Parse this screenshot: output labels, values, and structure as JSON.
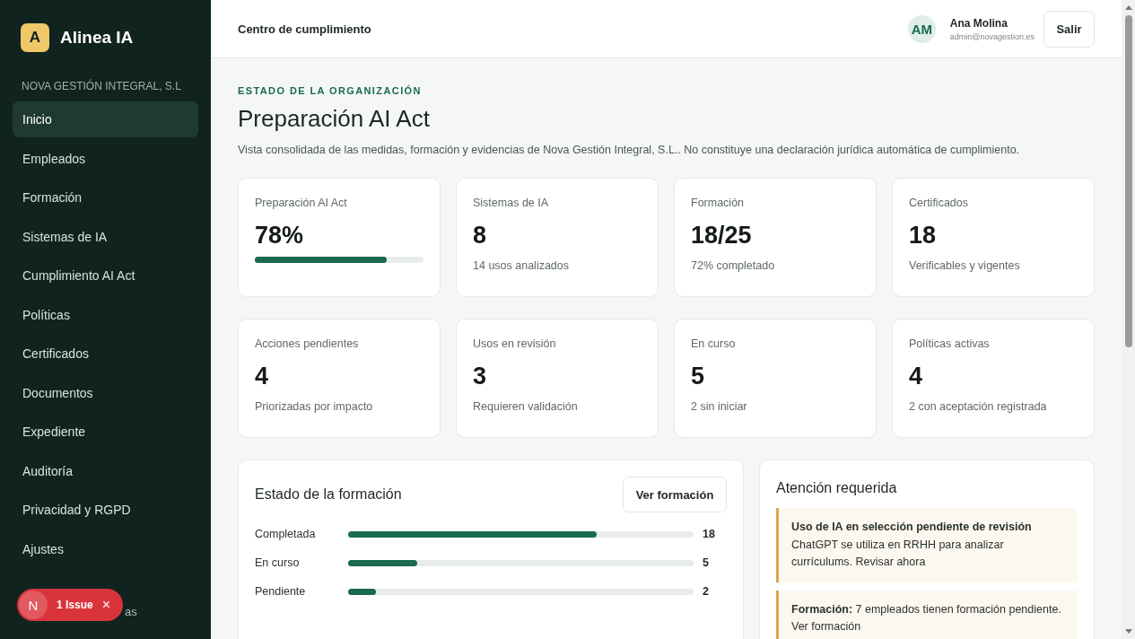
{
  "brand": {
    "logo_letter": "A",
    "name": "Alinea IA"
  },
  "organization": "NOVA GESTIÓN INTEGRAL, S.L",
  "sidebar": {
    "items": [
      {
        "label": "Inicio",
        "selected": true
      },
      {
        "label": "Empleados",
        "selected": false
      },
      {
        "label": "Formación",
        "selected": false
      },
      {
        "label": "Sistemas de IA",
        "selected": false
      },
      {
        "label": "Cumplimiento AI Act",
        "selected": false
      },
      {
        "label": "Políticas",
        "selected": false
      },
      {
        "label": "Certificados",
        "selected": false
      },
      {
        "label": "Documentos",
        "selected": false
      },
      {
        "label": "Expediente",
        "selected": false
      },
      {
        "label": "Auditoría",
        "selected": false
      },
      {
        "label": "Privacidad y RGPD",
        "selected": false
      },
      {
        "label": "Ajustes",
        "selected": false
      }
    ],
    "footer_fragment": "as"
  },
  "issue_badge": {
    "letter": "N",
    "label": "1 Issue",
    "close": "×"
  },
  "header": {
    "title": "Centro de cumplimiento",
    "user": {
      "initials": "AM",
      "name": "Ana Molina",
      "email": "admin@novagestion.es"
    },
    "logout": "Salir"
  },
  "page": {
    "eyebrow": "ESTADO DE LA ORGANIZACIÓN",
    "title": "Preparación AI Act",
    "description": "Vista consolidada de las medidas, formación y evidencias de Nova Gestión Integral, S.L.. No constituye una declaración jurídica automática de cumplimiento."
  },
  "stats": [
    {
      "kind": "progress",
      "label": "Preparación AI Act",
      "value": "78%",
      "level": 0.78
    },
    {
      "kind": "plain",
      "label": "Sistemas de IA",
      "value": "8",
      "note": "14 usos analizados"
    },
    {
      "kind": "plain",
      "label": "Formación",
      "value": "18/25",
      "note": "72% completado"
    },
    {
      "kind": "plain",
      "label": "Certificados",
      "value": "18",
      "note": "Verificables y vigentes"
    },
    {
      "kind": "plain",
      "label": "Acciones pendientes",
      "value": "4",
      "note": "Priorizadas por impacto"
    },
    {
      "kind": "plain",
      "label": "Usos en revisión",
      "value": "3",
      "note": "Requieren validación"
    },
    {
      "kind": "plain",
      "label": "En curso",
      "value": "5",
      "note": "2 sin iniciar"
    },
    {
      "kind": "plain",
      "label": "Políticas activas",
      "value": "4",
      "note": "2 con aceptación registrada"
    }
  ],
  "training": {
    "title": "Estado de la formación",
    "button": "Ver formación",
    "rows": [
      {
        "label": "Completada",
        "count": "18",
        "level": 0.72
      },
      {
        "label": "En curso",
        "count": "5",
        "level": 0.2
      },
      {
        "label": "Pendiente",
        "count": "2",
        "level": 0.08
      }
    ]
  },
  "attention": {
    "title": "Atención requerida",
    "alerts": [
      {
        "title": "Uso de IA en selección pendiente de revisión",
        "text": "ChatGPT se utiliza en RRHH para analizar currículums. Revisar ahora"
      },
      {
        "text": "**Formación:** 7 empleados tienen formación pendiente. Ver formación"
      }
    ]
  }
}
